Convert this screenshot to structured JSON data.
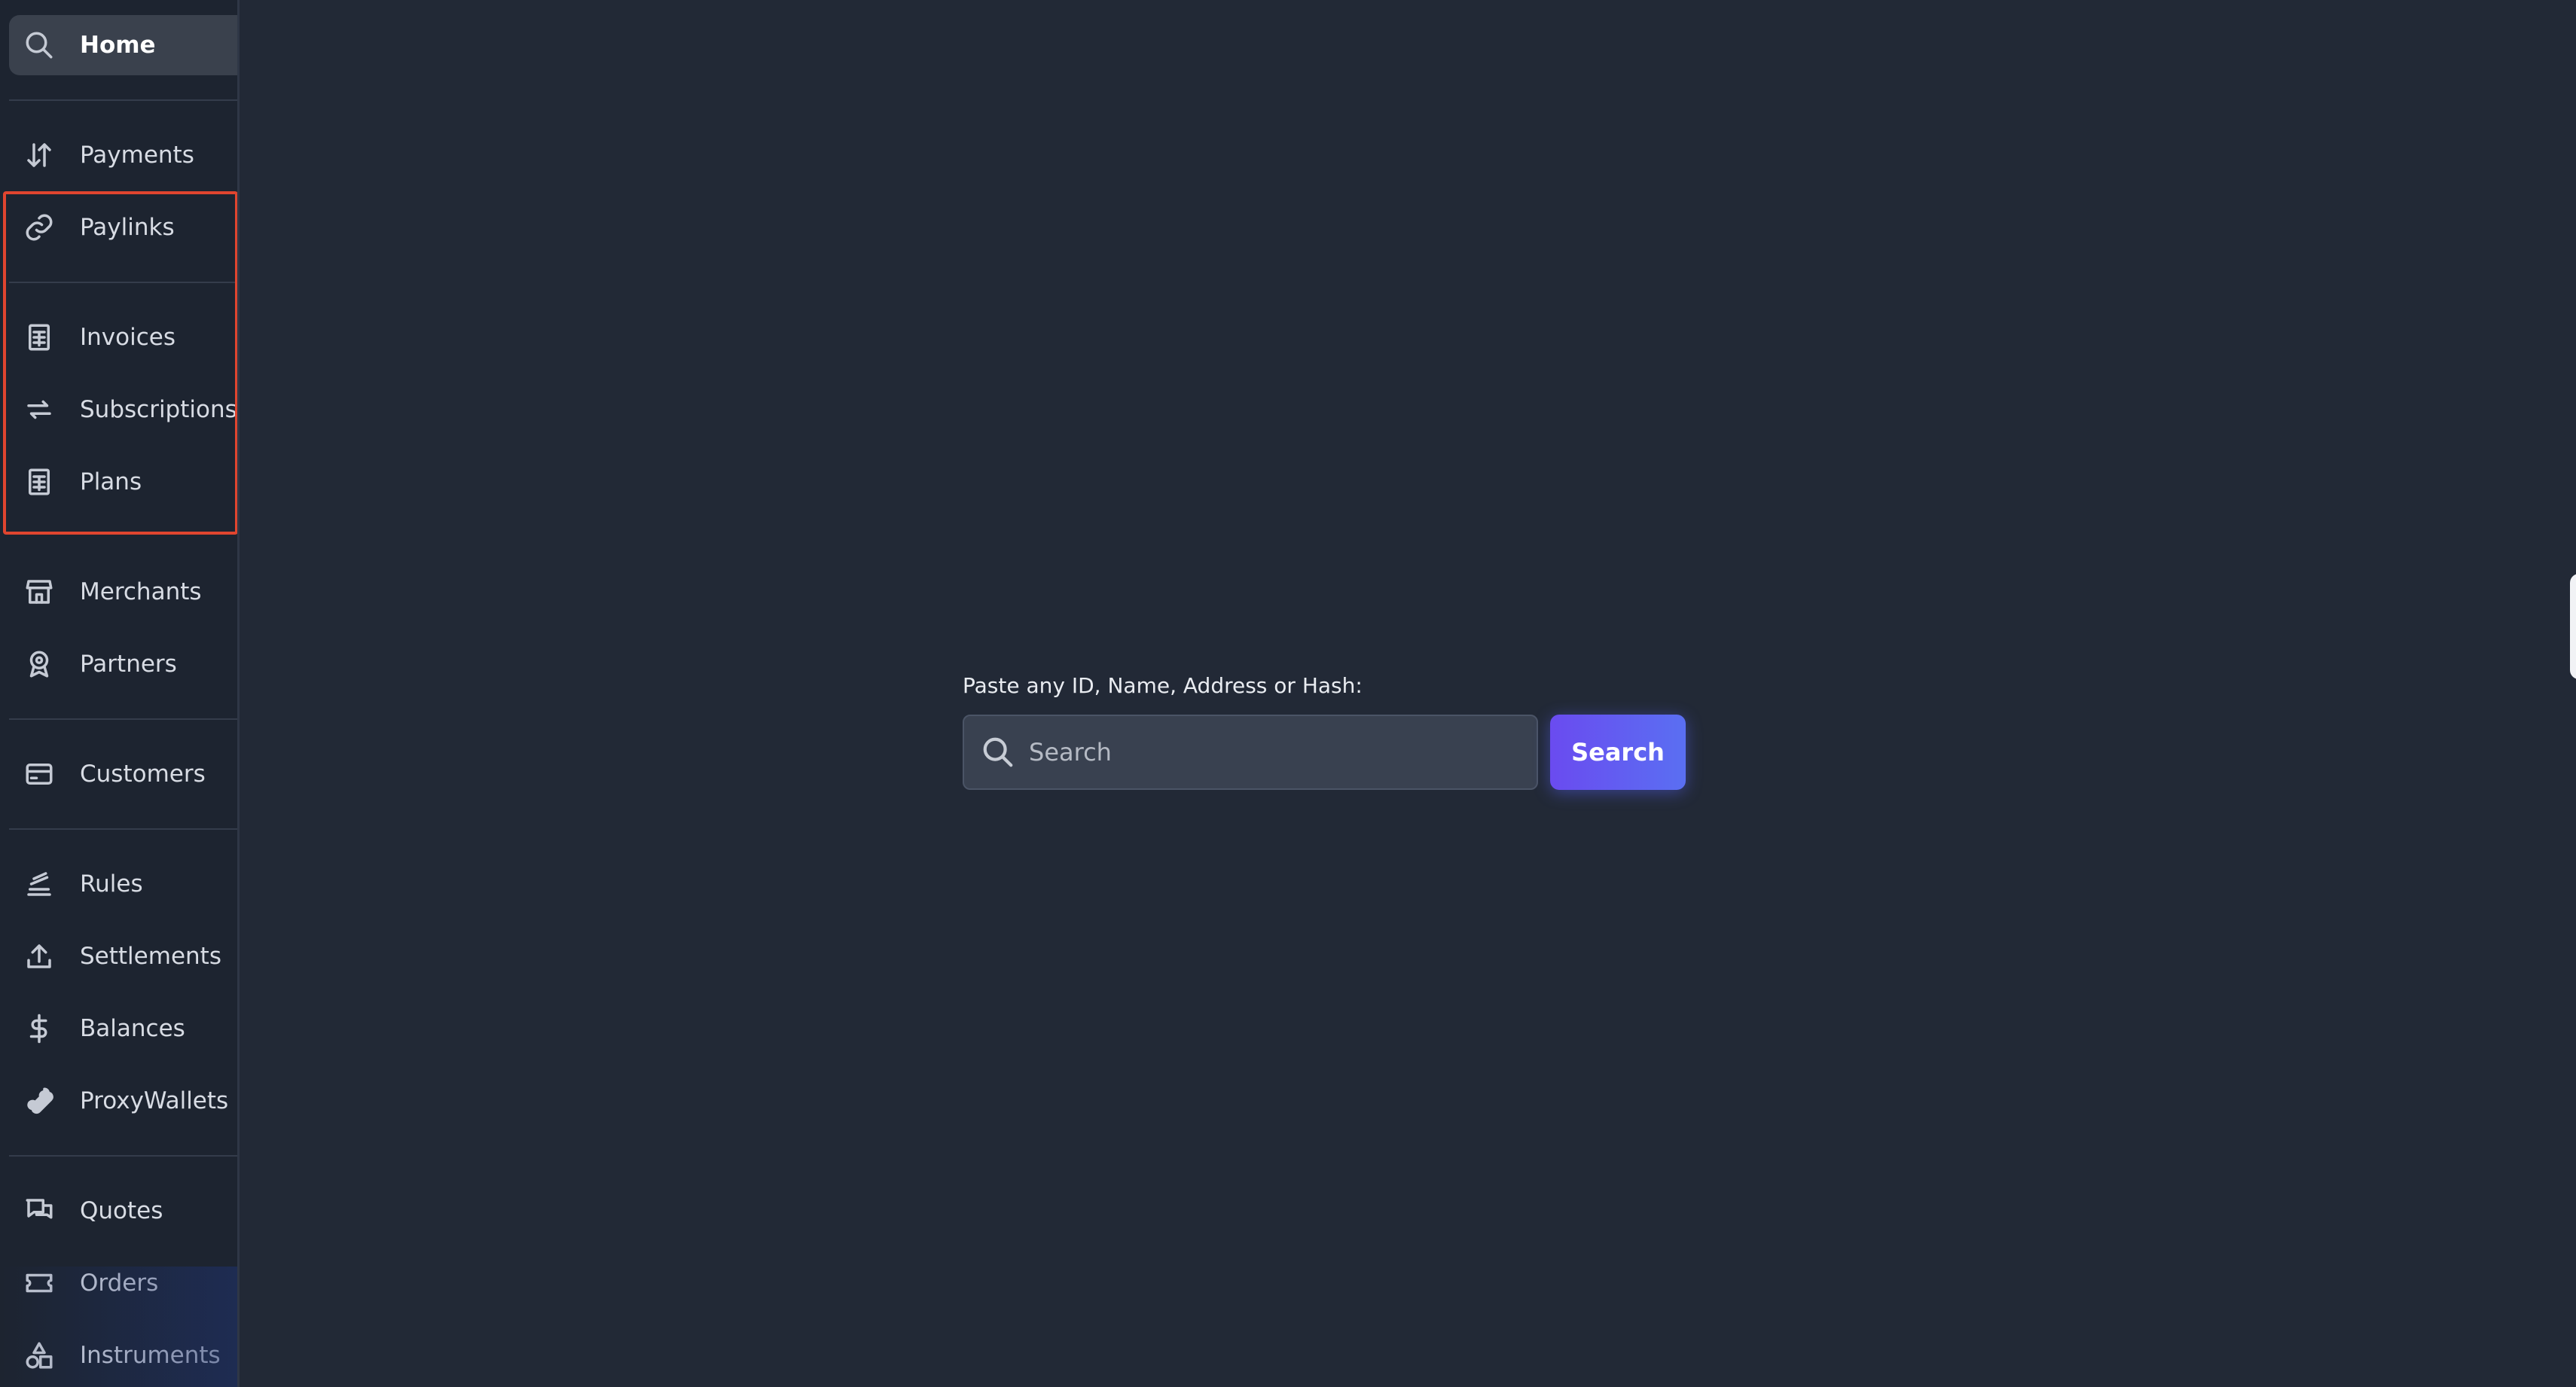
{
  "sidebar": {
    "items": [
      {
        "label": "Home",
        "icon": "search-icon",
        "active": true
      },
      {
        "label": "Payments",
        "icon": "arrows-up-down-icon"
      },
      {
        "label": "Paylinks",
        "icon": "link-icon"
      },
      {
        "label": "Invoices",
        "icon": "receipt-icon"
      },
      {
        "label": "Subscriptions",
        "icon": "repeat-icon"
      },
      {
        "label": "Plans",
        "icon": "receipt-icon"
      },
      {
        "label": "Merchants",
        "icon": "store-icon"
      },
      {
        "label": "Partners",
        "icon": "award-icon"
      },
      {
        "label": "Customers",
        "icon": "credit-card-icon"
      },
      {
        "label": "Rules",
        "icon": "stack-icon"
      },
      {
        "label": "Settlements",
        "icon": "upload-icon"
      },
      {
        "label": "Balances",
        "icon": "dollar-icon"
      },
      {
        "label": "ProxyWallets",
        "icon": "bone-icon"
      },
      {
        "label": "Quotes",
        "icon": "chat-icon"
      },
      {
        "label": "Orders",
        "icon": "ticket-icon"
      },
      {
        "label": "Instruments",
        "icon": "shapes-icon"
      }
    ]
  },
  "search": {
    "label": "Paste any ID, Name, Address or Hash:",
    "placeholder": "Search",
    "value": "",
    "button_label": "Search"
  },
  "colors": {
    "background": "#222936",
    "sidebar": "#1d2430",
    "active_item": "#3a414d",
    "highlight_border": "#e0452f",
    "button_start": "#6a4bf0",
    "button_end": "#5a6ff2"
  }
}
